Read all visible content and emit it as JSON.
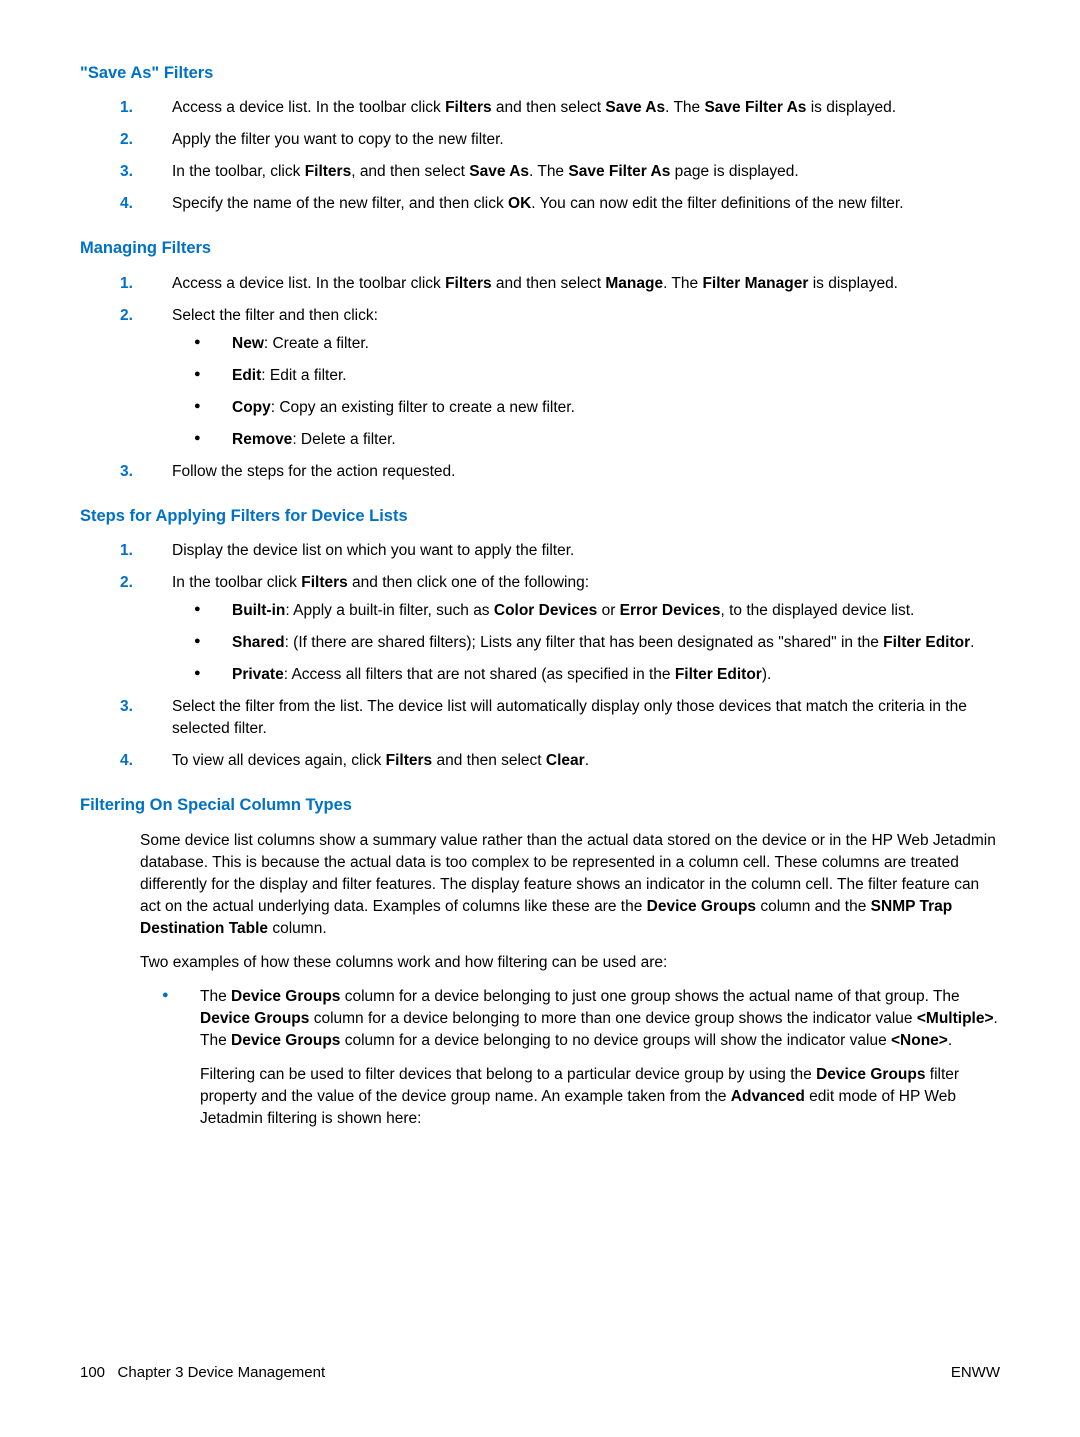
{
  "sections": {
    "saveas": {
      "heading": "\"Save As\" Filters",
      "items": [
        "Access a device list. In the toolbar click <b>Filters</b> and then select <b>Save As</b>. The <b>Save Filter As</b> is displayed.",
        "Apply the filter you want to copy to the new filter.",
        "In the toolbar, click <b>Filters</b>, and then select <b>Save As</b>. The <b>Save Filter As</b> page is displayed.",
        "Specify the name of the new filter, and then click <b>OK</b>. You can now edit the filter definitions of the new filter."
      ]
    },
    "managing": {
      "heading": "Managing Filters",
      "items": [
        "Access a device list. In the toolbar click <b>Filters</b> and then select <b>Manage</b>. The <b>Filter Manager</b> is displayed.",
        "Select the filter and then click:",
        "Follow the steps for the action requested."
      ],
      "subitems": [
        "<b>New</b>: Create a filter.",
        "<b>Edit</b>: Edit a filter.",
        "<b>Copy</b>: Copy an existing filter to create a new filter.",
        "<b>Remove</b>: Delete a filter."
      ]
    },
    "applying": {
      "heading": "Steps for Applying Filters for Device Lists",
      "items": [
        "Display the device list on which you want to apply the filter.",
        "In the toolbar click <b>Filters</b> and then click one of the following:",
        "Select the filter from the list. The device list will automatically display only those devices that match the criteria in the selected filter.",
        "To view all devices again, click <b>Filters</b> and then select <b>Clear</b>."
      ],
      "subitems": [
        "<b>Built-in</b>: Apply a built-in filter, such as <b>Color Devices</b> or <b>Error Devices</b>, to the displayed device list.",
        "<b>Shared</b>: (If there are shared filters); Lists any filter that has been designated as \"shared\" in the <b>Filter Editor</b>.",
        "<b>Private</b>: Access all filters that are not shared (as specified in the <b>Filter Editor</b>)."
      ]
    },
    "special": {
      "heading": "Filtering On Special Column Types",
      "para1": "Some device list columns show a summary value rather than the actual data stored on the device or in the HP Web Jetadmin database. This is because the actual data is too complex to be represented in a column cell. These columns are treated differently for the display and filter features. The display feature shows an indicator in the column cell. The filter feature can act on the actual underlying data. Examples of columns like these are the <b>Device Groups</b> column and the <b>SNMP Trap Destination Table</b> column.",
      "para2": "Two examples of how these columns work and how filtering can be used are:",
      "bullet1a": "The <b>Device Groups</b> column for a device belonging to just one group shows the actual name of that group. The <b>Device Groups</b> column for a device belonging to more than one device group shows the indicator value <b>&lt;Multiple&gt;</b>. The <b>Device Groups</b> column for a device belonging to no device groups will show the indicator value <b>&lt;None&gt;</b>.",
      "bullet1b": "Filtering can be used to filter devices that belong to a particular device group by using the <b>Device Groups</b> filter property and the value of the device group name. An example taken from the <b>Advanced</b> edit mode of HP Web Jetadmin filtering is shown here:"
    }
  },
  "footer": {
    "left_page": "100",
    "left_chapter": "Chapter 3   Device Management",
    "right": "ENWW"
  }
}
